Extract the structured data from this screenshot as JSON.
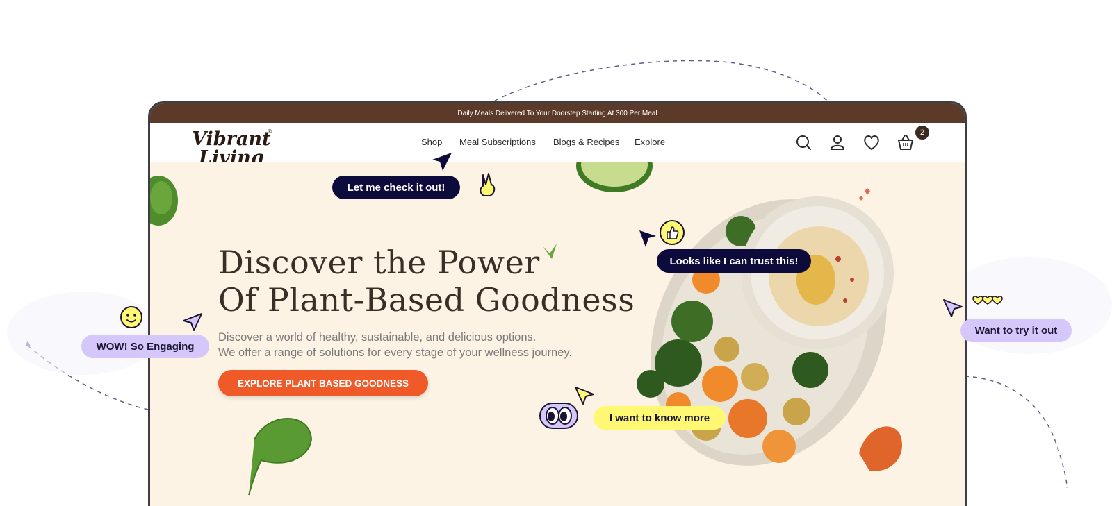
{
  "announcement": "Daily Meals Delivered To Your  Doorstep Starting At 300 Per Meal",
  "brand": {
    "line1": "Vibrant",
    "line2": "Living",
    "mark": "®"
  },
  "nav": {
    "items": [
      "Shop",
      "Meal Subscriptions",
      "Blogs & Recipes",
      "Explore"
    ]
  },
  "header_icons": [
    "search-icon",
    "account-icon",
    "wishlist-heart-icon",
    "cart-basket-icon"
  ],
  "cart_count": "2",
  "hero": {
    "title_line1": "Discover the Power",
    "title_line2": "Of Plant-Based Goodness",
    "subtitle_line1": "Discover a world of healthy, sustainable, and delicious options.",
    "subtitle_line2": "We offer a range of solutions for every stage of your wellness journey.",
    "cta": "EXPLORE PLANT BASED GOODNESS"
  },
  "reactions": {
    "check": "Let me check it out!",
    "trust": "Looks like I can trust this!",
    "wow": "WOW! So Engaging",
    "know": "I want to know more",
    "try": "Want to try it out"
  },
  "colors": {
    "top_bar": "#5b3a2a",
    "hero_bg": "#fdf3e4",
    "cta": "#ef5a28",
    "bubble_dark": "#0d0b3b",
    "bubble_lavender": "#d6c7fb",
    "bubble_yellow": "#fff873"
  }
}
